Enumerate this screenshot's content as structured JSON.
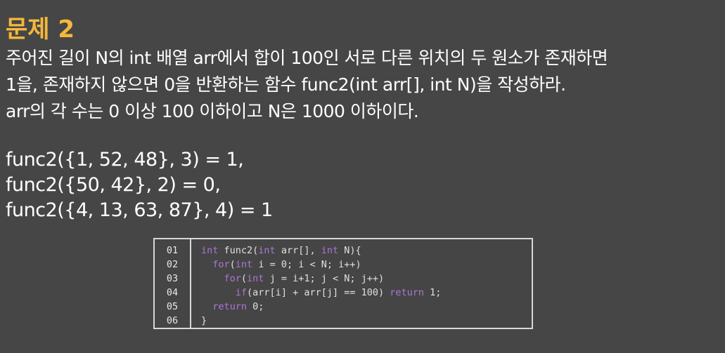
{
  "title": "문제 2",
  "description": [
    "주어진 길이 N의 int 배열 arr에서 합이 100인 서로 다른 위치의 두 원소가 존재하면",
    "1을, 존재하지 않으면 0을 반환하는 함수 func2(int arr[], int N)을 작성하라.",
    "arr의 각 수는 0 이상 100 이하이고 N은 1000 이하이다."
  ],
  "examples": [
    "func2({1, 52, 48}, 3) = 1,",
    "func2({50, 42}, 2) = 0,",
    "func2({4, 13, 63, 87}, 4) = 1"
  ],
  "code": {
    "line_numbers": [
      "01",
      "02",
      "03",
      "04",
      "05",
      "06"
    ],
    "lines": [
      [
        {
          "t": "int",
          "c": "kw"
        },
        {
          "t": " func2("
        },
        {
          "t": "int",
          "c": "kw"
        },
        {
          "t": " arr[], "
        },
        {
          "t": "int",
          "c": "kw"
        },
        {
          "t": " N){"
        }
      ],
      [
        {
          "t": "  "
        },
        {
          "t": "for",
          "c": "kw"
        },
        {
          "t": "("
        },
        {
          "t": "int",
          "c": "kw"
        },
        {
          "t": " i = 0; i < N; i++)"
        }
      ],
      [
        {
          "t": "    "
        },
        {
          "t": "for",
          "c": "kw"
        },
        {
          "t": "("
        },
        {
          "t": "int",
          "c": "kw"
        },
        {
          "t": " j = i+1; j < N; j++)"
        }
      ],
      [
        {
          "t": "      "
        },
        {
          "t": "if",
          "c": "kw"
        },
        {
          "t": "(arr[i] + arr[j] == 100) "
        },
        {
          "t": "return",
          "c": "kw"
        },
        {
          "t": " 1;"
        }
      ],
      [
        {
          "t": "  "
        },
        {
          "t": "return",
          "c": "kw"
        },
        {
          "t": " 0;"
        }
      ],
      [
        {
          "t": "}"
        }
      ]
    ]
  },
  "colors": {
    "background": "#464646",
    "title": "#f5b83d",
    "text": "#ffffff",
    "keyword": "#a978d6",
    "border": "#d8d8d8"
  }
}
